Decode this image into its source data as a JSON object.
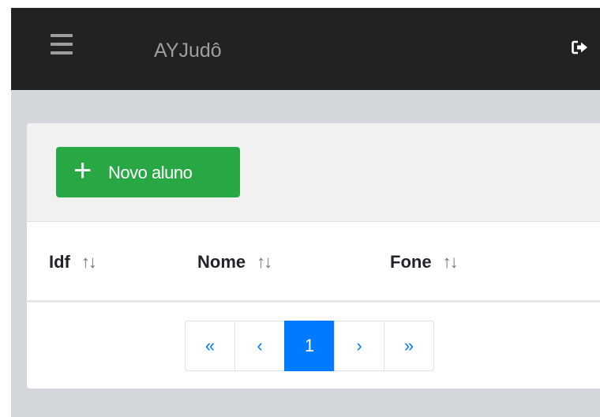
{
  "navbar": {
    "brand": "AYJudô",
    "menu_icon": "hamburger-menu-icon",
    "logout_icon": "sign-out-icon"
  },
  "toolbar": {
    "add_icon": "+",
    "add_label": "Novo aluno"
  },
  "table": {
    "columns": [
      {
        "label": "Idf",
        "sort": "↑↓"
      },
      {
        "label": "Nome",
        "sort": "↑↓"
      },
      {
        "label": "Fone",
        "sort": "↑↓"
      }
    ],
    "rows": []
  },
  "pagination": {
    "first": "«",
    "prev": "‹",
    "current": "1",
    "next": "›",
    "last": "»"
  },
  "colors": {
    "navbar_bg": "#222222",
    "success": "#28a745",
    "primary": "#007bff",
    "page_bg": "#d3d6da"
  }
}
